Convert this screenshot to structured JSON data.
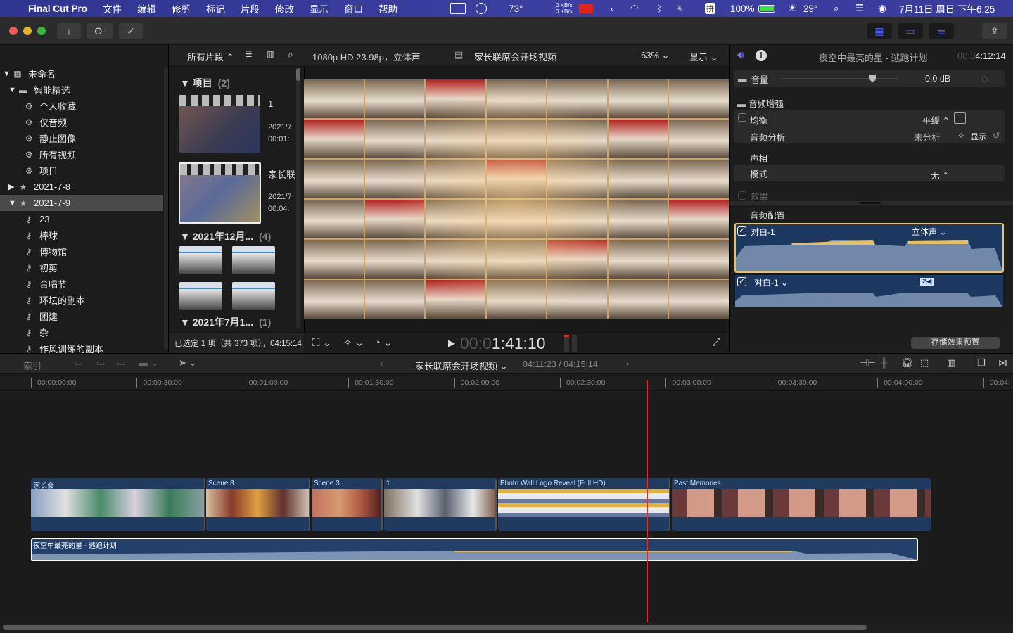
{
  "menubar": {
    "app": "Final Cut Pro",
    "items": [
      "文件",
      "编辑",
      "修剪",
      "标记",
      "片段",
      "修改",
      "显示",
      "窗口",
      "帮助"
    ],
    "status": {
      "cpu_temp": "73°",
      "net_up": "0 KB/s",
      "net_down": "0 KB/s",
      "battery": "100%",
      "weather": "29°",
      "datetime": "7月11日 周日 下午6:25"
    }
  },
  "library": {
    "items": [
      {
        "label": "未命名",
        "icon": "library-icon",
        "level": 0,
        "arrow": "▼"
      },
      {
        "label": "智能精选",
        "icon": "folder-icon",
        "level": 1,
        "arrow": "▼"
      },
      {
        "label": "个人收藏",
        "icon": "smart-collection-icon",
        "level": 2
      },
      {
        "label": "仅音频",
        "icon": "smart-collection-icon",
        "level": 2
      },
      {
        "label": "静止图像",
        "icon": "smart-collection-icon",
        "level": 2
      },
      {
        "label": "所有视频",
        "icon": "smart-collection-icon",
        "level": 2
      },
      {
        "label": "项目",
        "icon": "smart-collection-icon",
        "level": 2
      },
      {
        "label": "2021-7-8",
        "icon": "event-icon",
        "level": 1,
        "arrow": "▶"
      },
      {
        "label": "2021-7-9",
        "icon": "event-icon",
        "level": 1,
        "arrow": "▼",
        "selected": true
      },
      {
        "label": "23",
        "icon": "keyword-icon",
        "level": 2
      },
      {
        "label": "棒球",
        "icon": "keyword-icon",
        "level": 2
      },
      {
        "label": "博物馆",
        "icon": "keyword-icon",
        "level": 2
      },
      {
        "label": "初剪",
        "icon": "keyword-icon",
        "level": 2
      },
      {
        "label": "合唱节",
        "icon": "keyword-icon",
        "level": 2
      },
      {
        "label": "环坛的副本",
        "icon": "keyword-icon",
        "level": 2
      },
      {
        "label": "团建",
        "icon": "keyword-icon",
        "level": 2
      },
      {
        "label": "杂",
        "icon": "keyword-icon",
        "level": 2
      },
      {
        "label": "作风训练的副本",
        "icon": "keyword-icon",
        "level": 2
      }
    ]
  },
  "browser": {
    "filter": "所有片段",
    "sections": [
      {
        "title": "项目",
        "count": "(2)"
      },
      {
        "title": "2021年12月...",
        "count": "(4)"
      },
      {
        "title": "2021年7月1...",
        "count": "(1)"
      }
    ],
    "projects": [
      {
        "name": "1",
        "date": "2021/7",
        "duration": "00:01:"
      },
      {
        "name": "家长联",
        "date": "2021/7",
        "duration": "00:04:"
      }
    ],
    "footer": "已选定 1 项（共 373 项），04:15:14"
  },
  "viewer": {
    "format": "1080p HD 23.98p，立体声",
    "project": "家长联席会开场视频",
    "zoom": "63%",
    "display": "显示",
    "timecode_dim": "00:0",
    "timecode": "1:41:10"
  },
  "inspector": {
    "title": "夜空中最亮的星 - 逃跑计划",
    "duration_dim": "00:0",
    "duration": "4:12:14",
    "volume_label": "音量",
    "volume_value": "0.0 dB",
    "volume_level": 0.78,
    "enhance": "音频增强",
    "eq": "均衡",
    "eq_value": "平缓 ⌃",
    "analysis": "音频分析",
    "analysis_value": "未分析",
    "show": "显示",
    "pan": "声相",
    "mode": "模式",
    "mode_value": "无 ⌃",
    "effects": "效果",
    "config": "音频配置",
    "channels": [
      {
        "name": "对白-1",
        "format": "立体声"
      },
      {
        "name": "对白-1",
        "badge": "2"
      }
    ],
    "save_preset": "存储效果预置"
  },
  "timeline": {
    "index": "索引",
    "project": "家长联席会开场视频",
    "position": "04:11:23 / 04:15:14",
    "ruler": [
      "00:00:00:00",
      "00:00:30:00",
      "00:01:00:00",
      "00:01:30:00",
      "00:02:00:00",
      "00:02:30:00",
      "00:03:00:00",
      "00:03:30:00",
      "00:04:00:00",
      "00:04:"
    ],
    "clips": [
      "家长会",
      "Scene 8",
      "Scene 3",
      "1",
      "Photo Wall Logo Reveal (Full HD)",
      "Past Memories"
    ],
    "audio_clip": "夜空中最亮的星 - 逃跑计划"
  },
  "colors": {
    "accent": "#5d63ff",
    "clip": "#203a60",
    "playhead": "#d0342c",
    "selection": "#e7c55a"
  }
}
